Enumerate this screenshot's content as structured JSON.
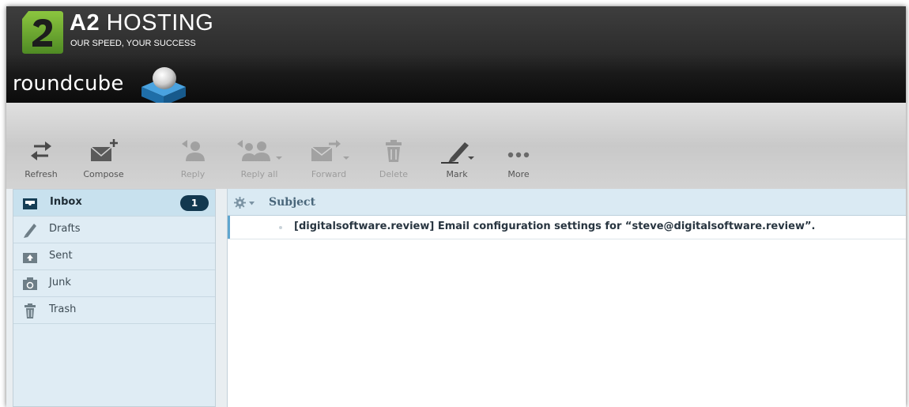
{
  "brand": {
    "name_bold": "A2",
    "name_rest": " HOSTING",
    "tagline": "OUR SPEED, YOUR SUCCESS",
    "app_name": "roundcube",
    "colors": {
      "logo_green": "#6aa23a",
      "cube_blue": "#2f86c6"
    }
  },
  "toolbar": {
    "buttons": [
      {
        "id": "refresh",
        "label": "Refresh",
        "icon": "refresh-icon",
        "enabled": true
      },
      {
        "id": "compose",
        "label": "Compose",
        "icon": "compose-icon",
        "enabled": true
      },
      {
        "id": "reply",
        "label": "Reply",
        "icon": "reply-icon",
        "enabled": false
      },
      {
        "id": "reply_all",
        "label": "Reply all",
        "icon": "reply-all-icon",
        "enabled": false
      },
      {
        "id": "forward",
        "label": "Forward",
        "icon": "forward-icon",
        "enabled": false
      },
      {
        "id": "delete",
        "label": "Delete",
        "icon": "trash-icon",
        "enabled": false
      },
      {
        "id": "mark",
        "label": "Mark",
        "icon": "mark-icon",
        "enabled": true
      },
      {
        "id": "more",
        "label": "More",
        "icon": "more-icon",
        "enabled": true
      }
    ]
  },
  "folders": [
    {
      "name": "Inbox",
      "icon": "inbox-icon",
      "unread": "1",
      "selected": true
    },
    {
      "name": "Drafts",
      "icon": "pencil-icon",
      "selected": false
    },
    {
      "name": "Sent",
      "icon": "sent-icon",
      "selected": false
    },
    {
      "name": "Junk",
      "icon": "junk-icon",
      "selected": false
    },
    {
      "name": "Trash",
      "icon": "trash-icon",
      "selected": false
    }
  ],
  "message_list": {
    "column_header": "Subject",
    "messages": [
      {
        "subject": "[digitalsoftware.review] Email configuration settings for “steve@digitalsoftware.review”.",
        "unread": true
      }
    ]
  }
}
